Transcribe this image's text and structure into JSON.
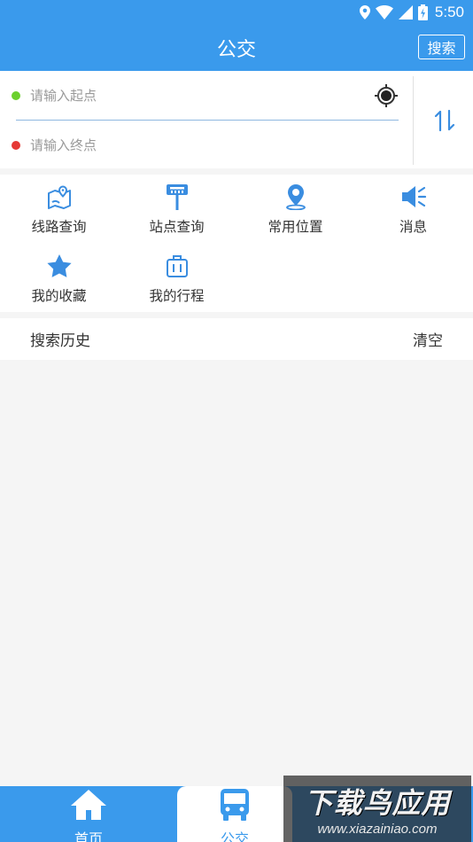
{
  "status_bar": {
    "time": "5:50",
    "icons": [
      "location-icon",
      "wifi-icon",
      "signal-icon",
      "battery-icon"
    ]
  },
  "header": {
    "title": "公交",
    "search_label": "搜索"
  },
  "route": {
    "start_placeholder": "请输入起点",
    "end_placeholder": "请输入终点",
    "start_value": "",
    "end_value": ""
  },
  "menu": [
    {
      "label": "线路查询",
      "icon": "route-map-icon"
    },
    {
      "label": "站点查询",
      "icon": "bus-stop-icon"
    },
    {
      "label": "常用位置",
      "icon": "location-pin-icon"
    },
    {
      "label": "消息",
      "icon": "speaker-icon"
    },
    {
      "label": "我的收藏",
      "icon": "star-icon"
    },
    {
      "label": "我的行程",
      "icon": "luggage-icon"
    }
  ],
  "history": {
    "title": "搜索历史",
    "clear_label": "清空"
  },
  "tabbar": {
    "items": [
      {
        "label": "首页",
        "icon": "home-icon"
      },
      {
        "label": "公交",
        "icon": "bus-icon",
        "active": true
      },
      {
        "label": "",
        "icon": ""
      }
    ]
  },
  "watermark": {
    "main": "下载鸟应用",
    "sub": "www.xiazainiao.com"
  },
  "colors": {
    "primary": "#3a9aec",
    "start_dot": "#6cd02e",
    "end_dot": "#e53935",
    "background": "#f5f5f5"
  }
}
